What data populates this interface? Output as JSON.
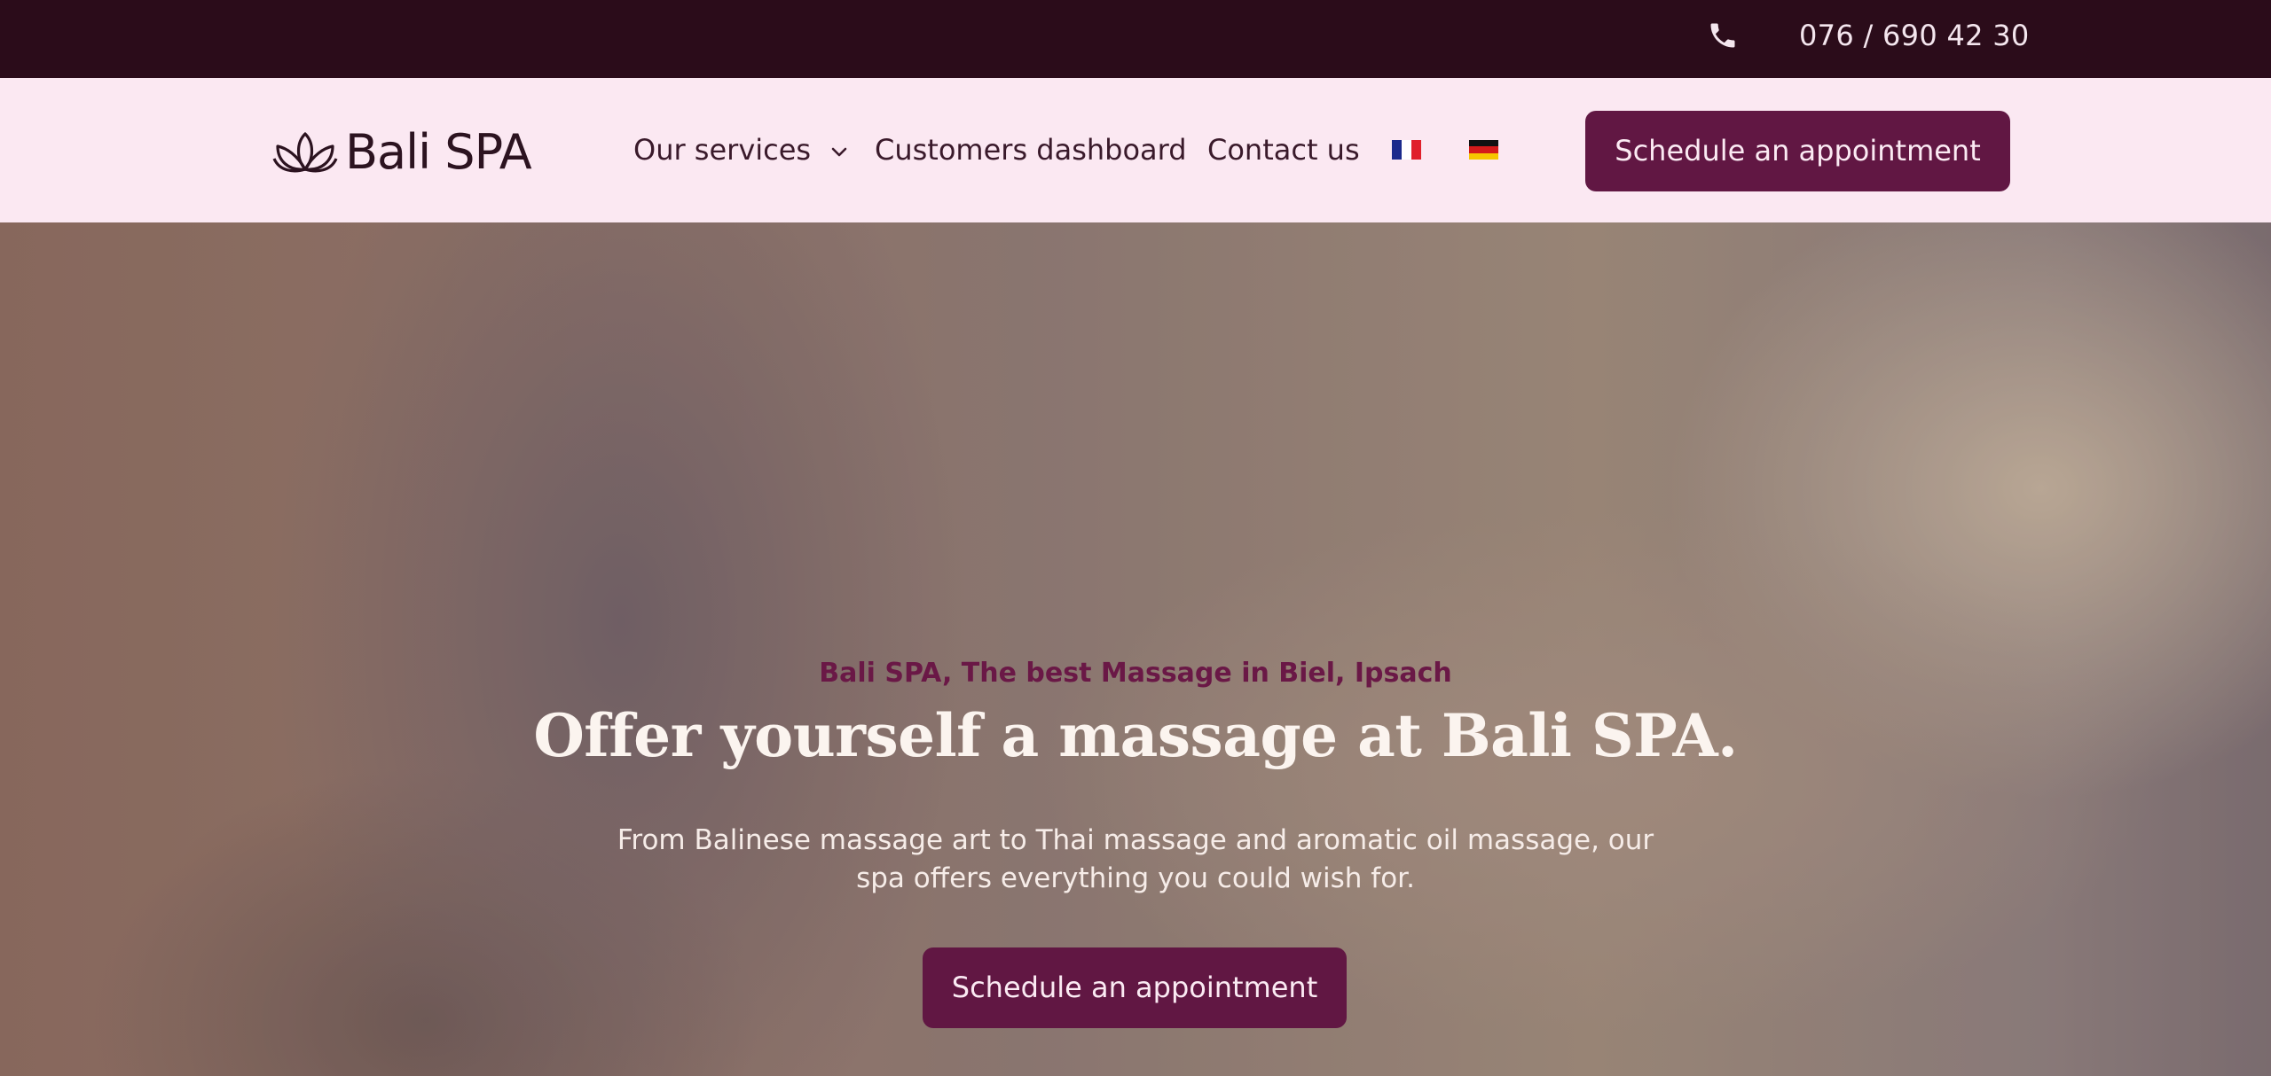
{
  "topbar": {
    "phone_icon": "phone-icon",
    "phone": "076 / 690 42 30"
  },
  "header": {
    "logo_text": "Bali SPA",
    "logo_icon": "lotus-icon",
    "nav": {
      "services": "Our services",
      "dashboard": "Customers dashboard",
      "contact": "Contact us"
    },
    "languages": [
      "fr-flag-icon",
      "de-flag-icon"
    ],
    "cta": "Schedule an appointment"
  },
  "hero": {
    "tagline": "Bali SPA, The best Massage in Biel, Ipsach",
    "headline": "Offer yourself a massage at Bali SPA.",
    "subtitle": "From Balinese massage art to Thai massage and aromatic oil massage, our spa offers everything you could wish for.",
    "cta": "Schedule an appointment"
  },
  "colors": {
    "topbar_bg": "#2b0c1a",
    "header_bg": "#fbe8f2",
    "accent": "#611743",
    "tagline": "#6a1846"
  }
}
